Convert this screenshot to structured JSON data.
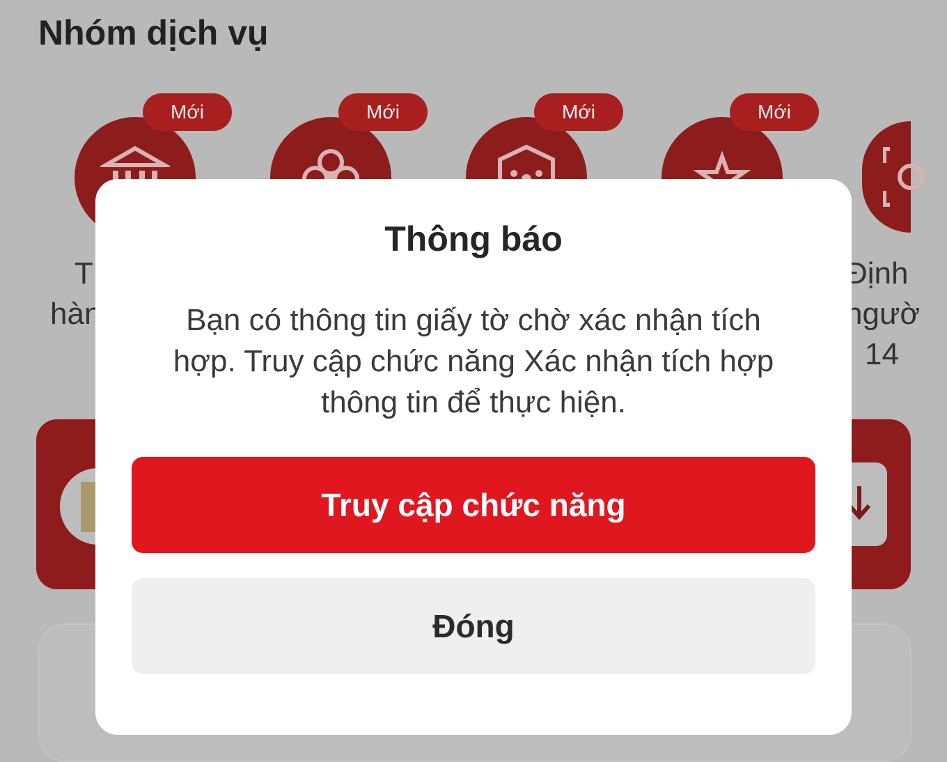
{
  "header": {
    "title": "Nhóm dịch vụ"
  },
  "services": {
    "badge_label": "Mới",
    "items": [
      {
        "icon": "government-building-icon",
        "label_line1": "T",
        "label_line2": "hàn"
      },
      {
        "icon": "apricot-blossom-icon",
        "label_line1": "",
        "label_line2": ""
      },
      {
        "icon": "shield-network-icon",
        "label_line1": "",
        "label_line2": ""
      },
      {
        "icon": "star-icon",
        "label_line1": "",
        "label_line2": ""
      },
      {
        "icon": "face-scan-icon",
        "label_line1": "Định",
        "label_line2": "ngườ",
        "label_line3": "14"
      }
    ]
  },
  "colors": {
    "accent_red": "#e0171f",
    "dimmed_icon_red": "#8d1c1c",
    "overlay_gray": "#b9b9b9"
  },
  "dialog": {
    "title": "Thông báo",
    "message_line1": "Bạn có thông tin giấy tờ chờ xác nhận tích",
    "message_line2": "hợp. Truy cập chức năng Xác nhận tích hợp",
    "message_line3": "thông tin để thực hiện.",
    "primary_button": "Truy cập chức năng",
    "secondary_button": "Đóng"
  }
}
